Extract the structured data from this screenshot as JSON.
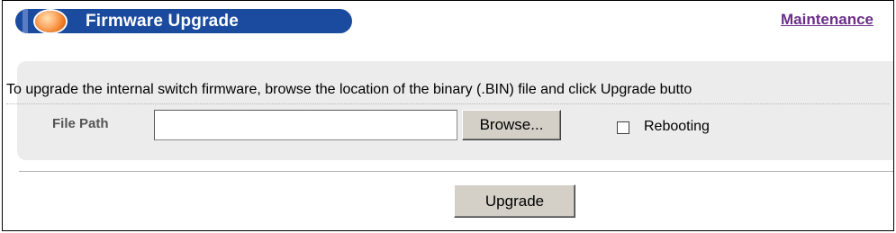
{
  "header": {
    "title": "Firmware Upgrade",
    "link": "Maintenance"
  },
  "panel": {
    "description": "To upgrade the internal switch firmware, browse the location of the binary (.BIN) file and click Upgrade butto",
    "file_path_label": "File Path",
    "file_path_value": "",
    "browse_label": "Browse...",
    "rebooting_label": "Rebooting",
    "rebooting_checked": false
  },
  "actions": {
    "upgrade_label": "Upgrade"
  },
  "colors": {
    "title_bar": "#1b4b9f",
    "link": "#6b2d88",
    "panel_bg": "#ececec",
    "button_face": "#d4d0c8"
  }
}
